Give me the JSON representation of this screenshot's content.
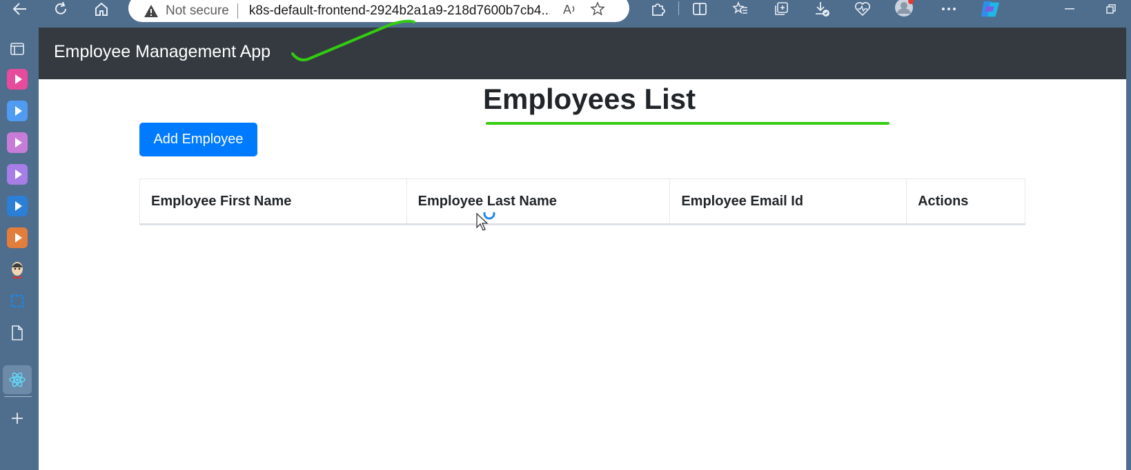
{
  "browser": {
    "security_label": "Not secure",
    "url": "k8s-default-frontend-2924b2a1a9-218d7600b7cb4...",
    "read_aloud_icon": "A̅⁾"
  },
  "app": {
    "brand": "Employee Management App",
    "page_title": "Employees List",
    "add_button_label": "Add Employee"
  },
  "table": {
    "columns": [
      "Employee First Name",
      "Employee Last Name",
      "Employee Email Id",
      "Actions"
    ],
    "rows": []
  },
  "colors": {
    "navbar": "#343a40",
    "primary": "#007bff",
    "annotation": "#33cc11",
    "browser_chrome": "#4f6d8c"
  }
}
